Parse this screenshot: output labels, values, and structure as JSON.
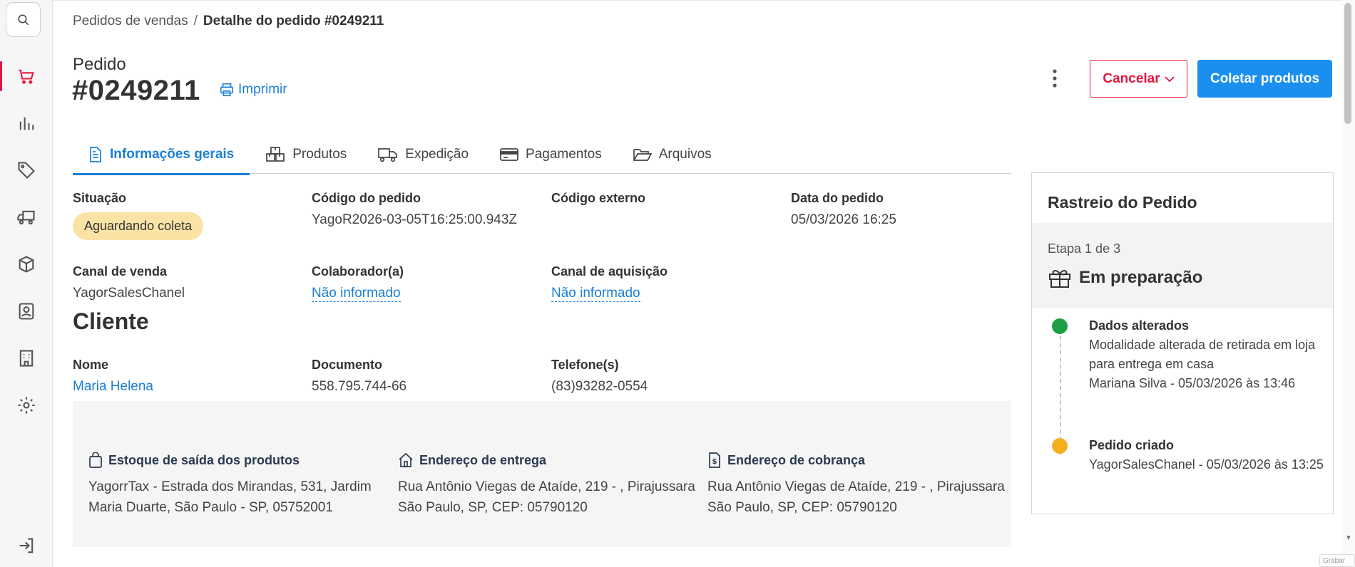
{
  "sidebar": {
    "items": [
      {
        "icon": "cart-icon"
      },
      {
        "icon": "chart-icon"
      },
      {
        "icon": "tag-icon"
      },
      {
        "icon": "truck-icon"
      },
      {
        "icon": "box-icon"
      },
      {
        "icon": "contact-icon"
      },
      {
        "icon": "building-icon"
      },
      {
        "icon": "gear-icon"
      }
    ],
    "logout_icon": "logout-icon",
    "accent_color": "#e0173c"
  },
  "breadcrumb": {
    "parent": "Pedidos de vendas",
    "separator": "/",
    "current": "Detalhe do pedido #0249211"
  },
  "header": {
    "label": "Pedido",
    "number": "#0249211",
    "print_label": "Imprimir",
    "cancel_label": "Cancelar",
    "collect_label": "Coletar produtos"
  },
  "tabs": [
    {
      "label": "Informações gerais",
      "icon": "document-icon",
      "active": true
    },
    {
      "label": "Produtos",
      "icon": "boxes-icon",
      "active": false
    },
    {
      "label": "Expedição",
      "icon": "truck-icon",
      "active": false
    },
    {
      "label": "Pagamentos",
      "icon": "card-icon",
      "active": false
    },
    {
      "label": "Arquivos",
      "icon": "folder-icon",
      "active": false
    }
  ],
  "info": {
    "situacao_label": "Situação",
    "situacao_value": "Aguardando coleta",
    "codigo_label": "Código do pedido",
    "codigo_value": "YagoR2026-03-05T16:25:00.943Z",
    "externo_label": "Código externo",
    "externo_value": "",
    "data_label": "Data do pedido",
    "data_value": "05/03/2026 16:25",
    "canal_venda_label": "Canal de venda",
    "canal_venda_value": "YagorSalesChanel",
    "colaborador_label": "Colaborador(a)",
    "colaborador_value": "Não informado",
    "canal_aquisicao_label": "Canal de aquisição",
    "canal_aquisicao_value": "Não informado"
  },
  "cliente": {
    "title": "Cliente",
    "nome_label": "Nome",
    "nome_value": "Maria Helena",
    "documento_label": "Documento",
    "documento_value": "558.795.744-66",
    "telefone_label": "Telefone(s)",
    "telefone_value": "(83)93282-0554"
  },
  "addresses": {
    "estoque_title": "Estoque de saída dos produtos",
    "estoque_text": "YagorrTax - Estrada dos Mirandas, 531, Jardim Maria Duarte, São Paulo - SP, 05752001",
    "entrega_title": "Endereço de entrega",
    "entrega_text": "Rua Antônio Viegas de Ataíde, 219 - , Pirajussara São Paulo, SP, CEP: 05790120",
    "cobranca_title": "Endereço de cobrança",
    "cobranca_text": "Rua Antônio Viegas de Ataíde, 219 - , Pirajussara São Paulo, SP, CEP: 05790120"
  },
  "tracking": {
    "title": "Rastreio do Pedido",
    "step": "Etapa 1 de 3",
    "stage": "Em preparação",
    "events": [
      {
        "title": "Dados alterados",
        "text": "Modalidade alterada de retirada em loja para entrega em casa",
        "meta": "Mariana Silva - 05/03/2026 às 13:46",
        "color": "#1e9e45"
      },
      {
        "title": "Pedido criado",
        "text": "YagorSalesChanel - 05/03/2026 às 13:25",
        "meta": "",
        "color": "#f2b01e"
      }
    ]
  },
  "corner_note": "Grabar"
}
